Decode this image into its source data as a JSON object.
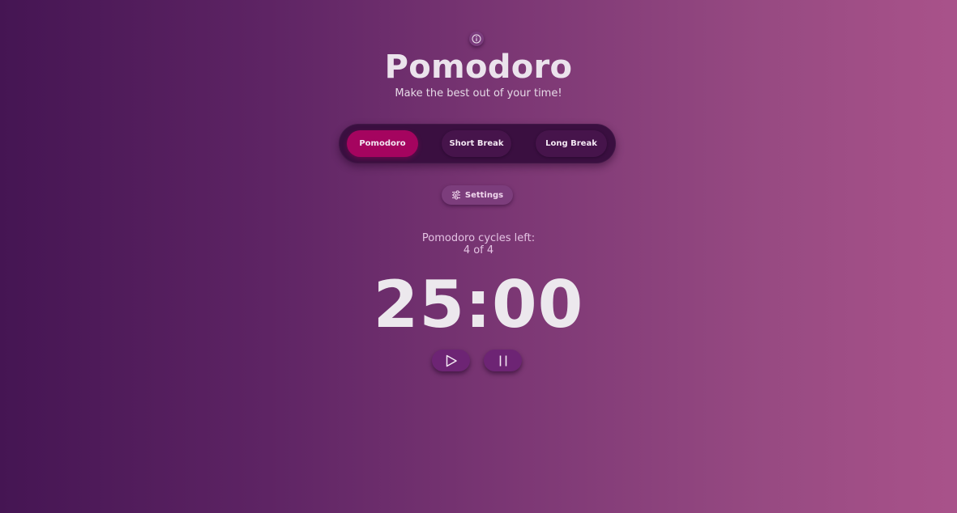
{
  "app": {
    "title": "Pomodoro",
    "subtitle": "Make the best out of your time!"
  },
  "modes": [
    {
      "label": "Pomodoro",
      "active": true
    },
    {
      "label": "Short Break",
      "active": false
    },
    {
      "label": "Long Break",
      "active": false
    }
  ],
  "settings": {
    "label": "Settings"
  },
  "cycles": {
    "label": "Pomodoro cycles left:",
    "count": "4 of 4"
  },
  "timer": {
    "display": "25:00"
  },
  "icons": {
    "info": "info-icon",
    "settings": "sliders-icon",
    "play": "play-icon",
    "pause": "pause-icon"
  },
  "colors": {
    "accent": "#a5045f",
    "mode_bar": "#3a0f40",
    "control_button": "#6d2474"
  }
}
